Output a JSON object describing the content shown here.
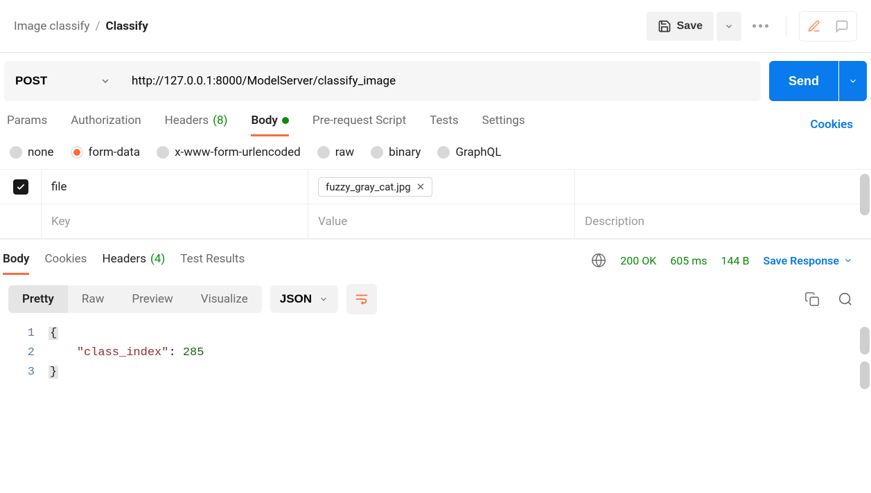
{
  "breadcrumb": {
    "workspace": "Image classify",
    "request": "Classify"
  },
  "topbar": {
    "save_label": "Save"
  },
  "request": {
    "method": "POST",
    "url": "http://127.0.0.1:8000/ModelServer/classify_image",
    "send_label": "Send"
  },
  "request_tabs": {
    "params": "Params",
    "authorization": "Authorization",
    "headers": "Headers",
    "headers_count": "(8)",
    "body": "Body",
    "prerequest": "Pre-request Script",
    "tests": "Tests",
    "settings": "Settings",
    "cookies_link": "Cookies"
  },
  "body_types": {
    "none": "none",
    "form_data": "form-data",
    "x_www": "x-www-form-urlencoded",
    "raw": "raw",
    "binary": "binary",
    "graphql": "GraphQL"
  },
  "form_data": {
    "row": {
      "checked": true,
      "key": "file",
      "value_file": "fuzzy_gray_cat.jpg"
    },
    "placeholders": {
      "key": "Key",
      "value": "Value",
      "description": "Description"
    }
  },
  "response_tabs": {
    "body": "Body",
    "cookies": "Cookies",
    "headers": "Headers",
    "headers_count": "(4)",
    "test_results": "Test Results"
  },
  "response_meta": {
    "status": "200 OK",
    "time": "605 ms",
    "size": "144 B",
    "save_response": "Save Response"
  },
  "response_view": {
    "pretty": "Pretty",
    "raw": "Raw",
    "preview": "Preview",
    "visualize": "Visualize",
    "format": "JSON"
  },
  "response_body": {
    "key": "class_index",
    "value": 285
  }
}
